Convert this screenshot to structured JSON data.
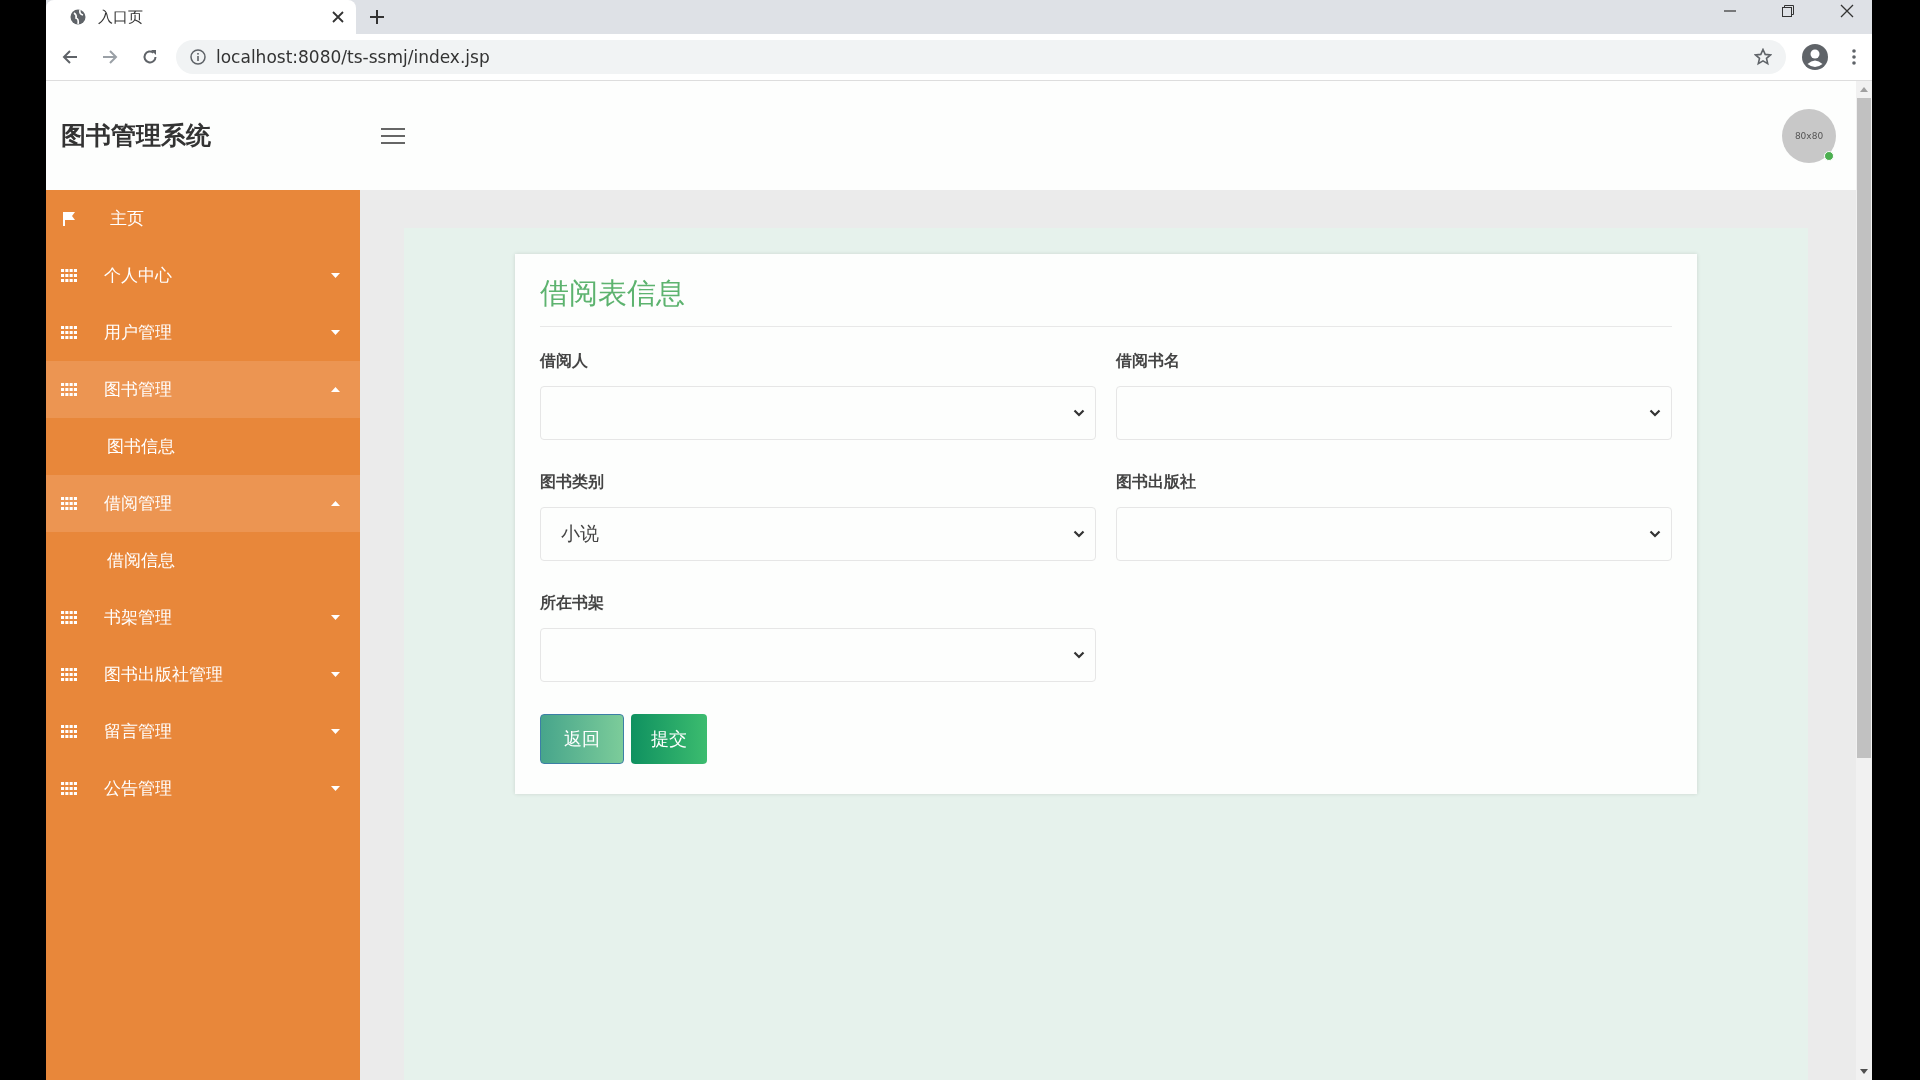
{
  "browser": {
    "tab_title": "入口页",
    "url": "localhost:8080/ts-ssmj/index.jsp"
  },
  "header": {
    "title": "图书管理系统",
    "avatar_text": "80x80",
    "online": true
  },
  "sidebar": {
    "items": [
      {
        "label": "主页",
        "kind": "link",
        "expanded": false
      },
      {
        "label": "个人中心",
        "kind": "group",
        "expanded": false
      },
      {
        "label": "用户管理",
        "kind": "group",
        "expanded": false
      },
      {
        "label": "图书管理",
        "kind": "group",
        "expanded": true,
        "children": [
          {
            "label": "图书信息"
          }
        ]
      },
      {
        "label": "借阅管理",
        "kind": "group",
        "expanded": true,
        "children": [
          {
            "label": "借阅信息"
          }
        ]
      },
      {
        "label": "书架管理",
        "kind": "group",
        "expanded": false
      },
      {
        "label": "图书出版社管理",
        "kind": "group",
        "expanded": false
      },
      {
        "label": "留言管理",
        "kind": "group",
        "expanded": false
      },
      {
        "label": "公告管理",
        "kind": "group",
        "expanded": false
      }
    ]
  },
  "form": {
    "title": "借阅表信息",
    "fields": [
      {
        "label": "借阅人"
      },
      {
        "label": "借阅书名"
      },
      {
        "label": "图书类别",
        "value": "小说"
      },
      {
        "label": "图书出版社"
      },
      {
        "label": "所在书架"
      }
    ],
    "buttons": [
      {
        "label": "返回",
        "hovered": true
      },
      {
        "label": "提交",
        "hovered": false
      }
    ]
  }
}
